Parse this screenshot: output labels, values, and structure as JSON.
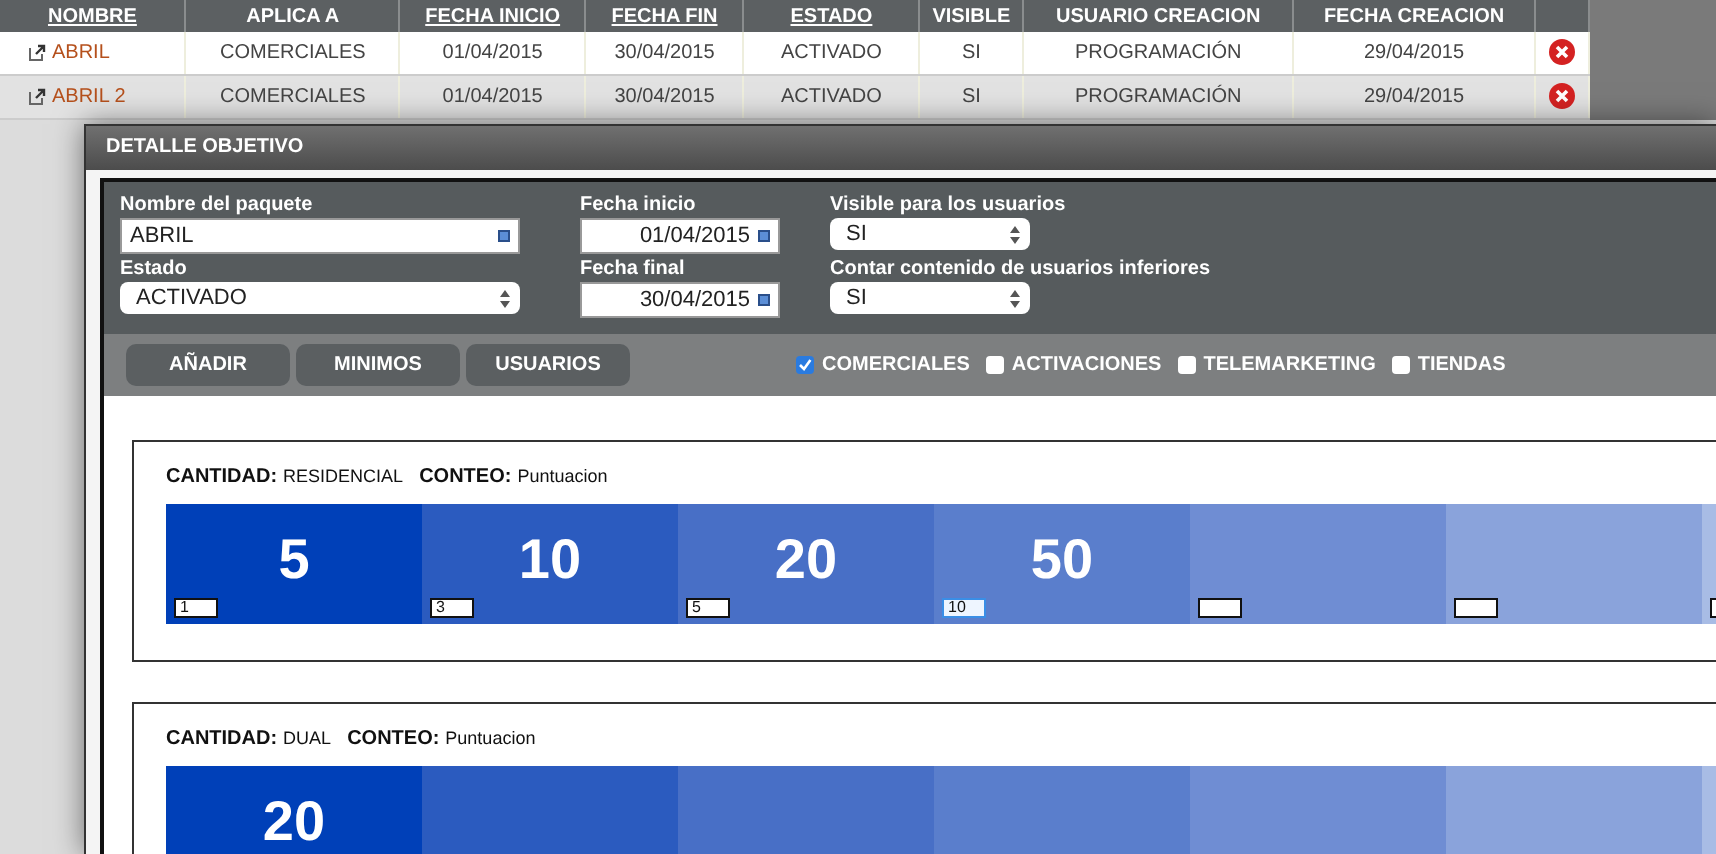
{
  "table": {
    "columns": [
      {
        "label": "NOMBRE",
        "sortable": true
      },
      {
        "label": "APLICA A",
        "sortable": false
      },
      {
        "label": "FECHA INICIO",
        "sortable": true
      },
      {
        "label": "FECHA FIN",
        "sortable": true
      },
      {
        "label": "ESTADO",
        "sortable": true
      },
      {
        "label": "VISIBLE",
        "sortable": false
      },
      {
        "label": "USUARIO CREACION",
        "sortable": false
      },
      {
        "label": "FECHA CREACION",
        "sortable": false
      }
    ],
    "rows": [
      {
        "cells": [
          "ABRIL",
          "COMERCIALES",
          "01/04/2015",
          "30/04/2015",
          "ACTIVADO",
          "SI",
          "PROGRAMACIÓN",
          "29/04/2015"
        ]
      },
      {
        "cells": [
          "ABRIL 2",
          "COMERCIALES",
          "01/04/2015",
          "30/04/2015",
          "ACTIVADO",
          "SI",
          "PROGRAMACIÓN",
          "29/04/2015"
        ]
      }
    ]
  },
  "dialog": {
    "title": "DETALLE OBJETIVO",
    "fields": [
      {
        "kind": "text",
        "label": "Nombre del paquete",
        "value": "ABRIL"
      },
      {
        "kind": "date",
        "label": "Fecha inicio",
        "value": "01/04/2015"
      },
      {
        "kind": "select",
        "label": "Visible para los usuarios",
        "value": "SI"
      },
      {
        "kind": "select",
        "label": "Estado",
        "value": "ACTIVADO"
      },
      {
        "kind": "date",
        "label": "Fecha final",
        "value": "30/04/2015"
      },
      {
        "kind": "select",
        "label": "Contar contenido de usuarios inferiores",
        "value": "SI"
      }
    ],
    "buttons": [
      "AÑADIR",
      "MINIMOS",
      "USUARIOS"
    ],
    "filters": [
      {
        "label": "COMERCIALES",
        "checked": true
      },
      {
        "label": "ACTIVACIONES",
        "checked": false
      },
      {
        "label": "TELEMARKETING",
        "checked": false
      },
      {
        "label": "TIENDAS",
        "checked": false
      }
    ],
    "objectives": [
      {
        "cantidad_label": "CANTIDAD:",
        "cantidad": "RESIDENCIAL",
        "conteo_label": "CONTEO:",
        "conteo": "Puntuacion",
        "tiers": [
          {
            "color": "#0040b8",
            "value": "5",
            "input": "1",
            "focused": false
          },
          {
            "color": "#2b5bbf",
            "value": "10",
            "input": "3",
            "focused": false
          },
          {
            "color": "#486fc6",
            "value": "20",
            "input": "5",
            "focused": false
          },
          {
            "color": "#5a7ecc",
            "value": "50",
            "input": "10",
            "focused": true
          },
          {
            "color": "#6f8dd3",
            "focused": false
          },
          {
            "color": "#8aa3db",
            "focused": false
          },
          {
            "color": "#a8bce5",
            "focused": false
          }
        ]
      },
      {
        "cantidad_label": "CANTIDAD:",
        "cantidad": "DUAL",
        "conteo_label": "CONTEO:",
        "conteo": "Puntuacion",
        "tiers": [
          {
            "color": "#0040b8",
            "value": "20"
          },
          {
            "color": "#2b5bbf"
          },
          {
            "color": "#486fc6"
          },
          {
            "color": "#5a7ecc"
          },
          {
            "color": "#6f8dd3"
          },
          {
            "color": "#8aa3db"
          },
          {
            "color": "#a8bce5"
          }
        ]
      }
    ]
  }
}
